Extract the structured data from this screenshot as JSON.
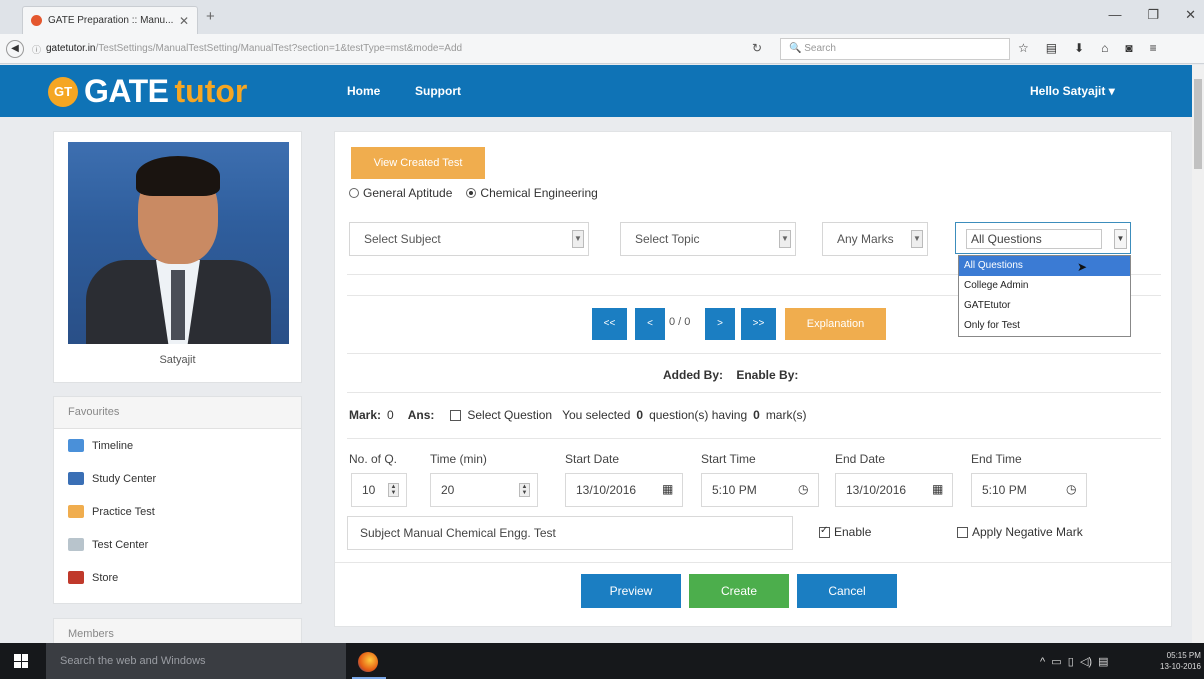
{
  "browser": {
    "tab_title": "GATE Preparation :: Manu...",
    "url_domain": "gatetutor.in",
    "url_path": "/TestSettings/ManualTestSetting/ManualTest?section=1&testType=mst&mode=Add",
    "search_placeholder": "Search"
  },
  "site": {
    "logo_badge": "GT",
    "logo_word1": "GATE",
    "logo_word2": "tutor",
    "nav": [
      "Home",
      "Support"
    ],
    "greeting": "Hello Satyajit"
  },
  "profile": {
    "name": "Satyajit"
  },
  "favourites": {
    "title": "Favourites",
    "items": [
      "Timeline",
      "Study Center",
      "Practice Test",
      "Test Center",
      "Store"
    ]
  },
  "members": {
    "title": "Members"
  },
  "main": {
    "view_created_test": "View Created Test",
    "radio_options": [
      "General Aptitude",
      "Chemical Engineering"
    ],
    "selected_radio": "Chemical Engineering",
    "select_subject": "Select Subject",
    "select_topic": "Select Topic",
    "any_marks": "Any Marks",
    "question_filter": "All Questions",
    "question_filter_options": [
      "All Questions",
      "College Admin",
      "GATEtutor",
      "Only for Test"
    ],
    "pager": {
      "first": "<<",
      "prev": "<",
      "status": "0 / 0",
      "next": ">",
      "last": ">>",
      "explanation": "Explanation"
    },
    "added_by_label": "Added By:",
    "enable_by_label": "Enable By:",
    "mark_label": "Mark:",
    "mark_value": "0",
    "ans_label": "Ans:",
    "select_question_label": "Select Question",
    "selected_prefix": "You selected",
    "selected_count": "0",
    "selected_middle": "question(s) having",
    "selected_marks": "0",
    "selected_suffix": "mark(s)",
    "fields": {
      "no_of_q_label": "No. of Q.",
      "no_of_q": "10",
      "time_label": "Time (min)",
      "time": "20",
      "start_date_label": "Start Date",
      "start_date": "13/10/2016",
      "start_time_label": "Start Time",
      "start_time": "5:10 PM",
      "end_date_label": "End Date",
      "end_date": "13/10/2016",
      "end_time_label": "End Time",
      "end_time": "5:10 PM"
    },
    "test_name": "Subject Manual  Chemical Engg. Test",
    "enable_label": "Enable",
    "negative_mark_label": "Apply Negative Mark",
    "buttons": [
      "Preview",
      "Create",
      "Cancel"
    ]
  },
  "taskbar": {
    "search_text": "Search the web and Windows",
    "time": "05:15 PM",
    "date": "13-10-2016"
  },
  "colors": {
    "header_blue": "#0f73b6",
    "orange": "#f0ad4e",
    "green": "#4cae4c",
    "button_blue": "#1b7ec2"
  }
}
